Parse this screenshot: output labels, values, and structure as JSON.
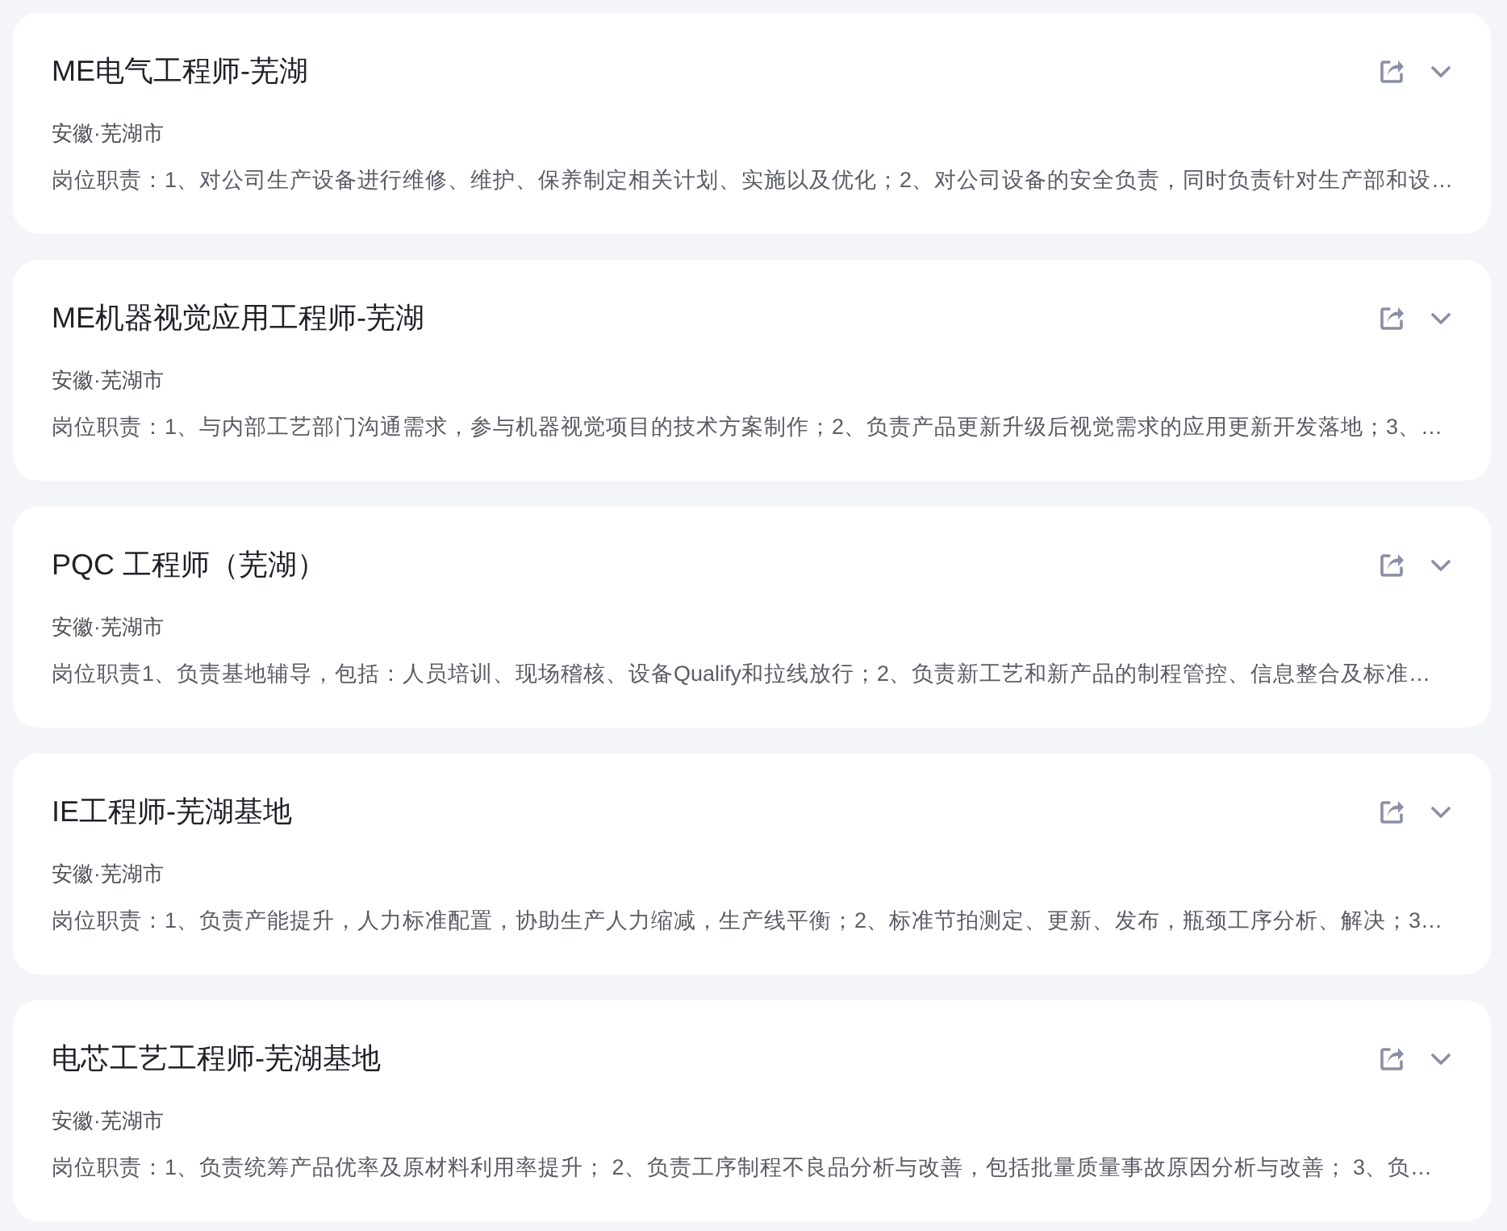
{
  "jobs": [
    {
      "title": "ME电气工程师-芜湖",
      "location": "安徽·芜湖市",
      "description": "岗位职责：1、对公司生产设备进行维修、维护、保养制定相关计划、实施以及优化；2、对公司设备的安全负责，同时负责针对生产部和设…",
      "expanded": false
    },
    {
      "title": "ME机器视觉应用工程师-芜湖",
      "location": "安徽·芜湖市",
      "description": "岗位职责：1、与内部工艺部门沟通需求，参与机器视觉项目的技术方案制作；2、负责产品更新升级后视觉需求的应用更新开发落地；3、…",
      "expanded": false
    },
    {
      "title": "PQC 工程师（芜湖）",
      "location": "安徽·芜湖市",
      "description": "岗位职责1、负责基地辅导，包括：人员培训、现场稽核、设备Qualify和拉线放行；2、负责新工艺和新产品的制程管控、信息整合及标准…",
      "expanded": false
    },
    {
      "title": "IE工程师-芜湖基地",
      "location": "安徽·芜湖市",
      "description": "岗位职责：1、负责产能提升，人力标准配置，协助生产人力缩减，生产线平衡；2、标准节拍测定、更新、发布，瓶颈工序分析、解决；3…",
      "expanded": false
    },
    {
      "title": "电芯工艺工程师-芜湖基地",
      "location": "安徽·芜湖市",
      "description": "岗位职责：1、负责统筹产品优率及原材料利用率提升； 2、负责工序制程不良品分析与改善，包括批量质量事故原因分析与改善； 3、负…",
      "expanded": false
    }
  ]
}
